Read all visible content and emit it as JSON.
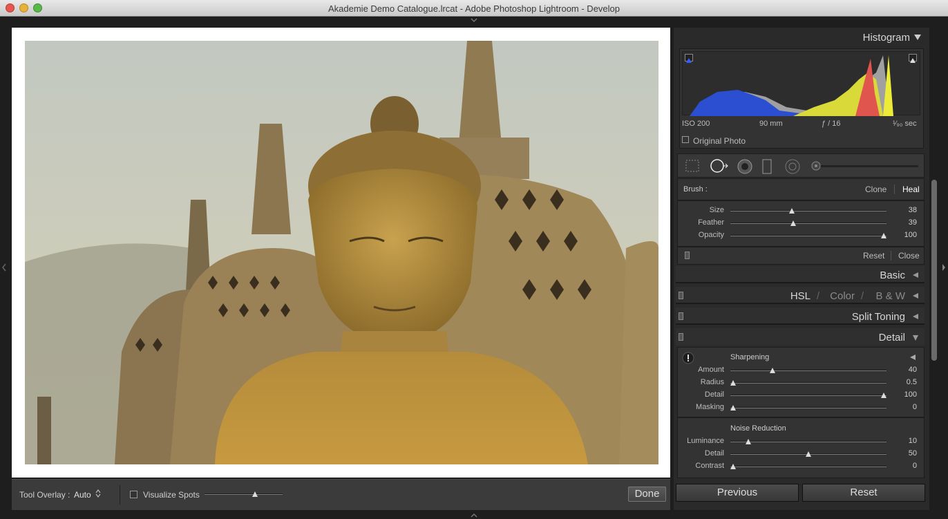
{
  "window": {
    "title": "Akademie Demo Catalogue.lrcat - Adobe Photoshop Lightroom - Develop"
  },
  "toolbar": {
    "tool_overlay_label": "Tool Overlay :",
    "tool_overlay_value": "Auto",
    "visualize_spots_label": "Visualize Spots",
    "visualize_spots_threshold": 0.66,
    "done_label": "Done"
  },
  "histogram": {
    "title": "Histogram",
    "iso": "ISO 200",
    "focal": "90 mm",
    "aperture": "ƒ / 16",
    "shutter": "¹⁄₉₀ sec",
    "original_photo_label": "Original Photo"
  },
  "brush": {
    "label": "Brush :",
    "clone_label": "Clone",
    "heal_label": "Heal",
    "active": "Heal",
    "sliders": [
      {
        "label": "Size",
        "value": "38",
        "pos": 0.39
      },
      {
        "label": "Feather",
        "value": "39",
        "pos": 0.4
      },
      {
        "label": "Opacity",
        "value": "100",
        "pos": 1.0
      }
    ],
    "reset_label": "Reset",
    "close_label": "Close"
  },
  "panels": {
    "basic": "Basic",
    "hsl": "HSL",
    "color": "Color",
    "bw": "B & W",
    "split_toning": "Split Toning",
    "detail": "Detail"
  },
  "sharpening": {
    "title": "Sharpening",
    "sliders": [
      {
        "label": "Amount",
        "value": "40",
        "pos": 0.26
      },
      {
        "label": "Radius",
        "value": "0.5",
        "pos": 0.0
      },
      {
        "label": "Detail",
        "value": "100",
        "pos": 1.0
      },
      {
        "label": "Masking",
        "value": "0",
        "pos": 0.0
      }
    ]
  },
  "noise": {
    "title": "Noise Reduction",
    "sliders": [
      {
        "label": "Luminance",
        "value": "10",
        "pos": 0.1
      },
      {
        "label": "Detail",
        "value": "50",
        "pos": 0.5
      },
      {
        "label": "Contrast",
        "value": "0",
        "pos": 0.0
      }
    ]
  },
  "buttons": {
    "previous": "Previous",
    "reset": "Reset"
  },
  "colors": {
    "accent_red": "#e2504a",
    "panel_bg": "#2a2a2a",
    "header_text": "#d6d6d6"
  }
}
